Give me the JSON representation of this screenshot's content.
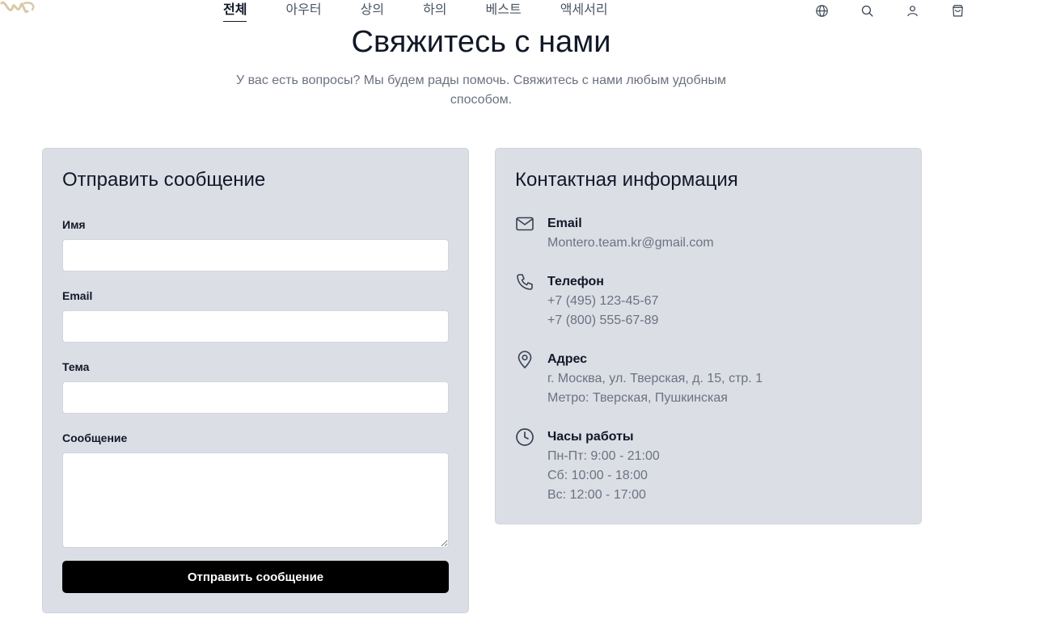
{
  "nav": {
    "items": [
      {
        "label": "전체",
        "active": true
      },
      {
        "label": "아우터"
      },
      {
        "label": "상의"
      },
      {
        "label": "하의"
      },
      {
        "label": "베스트"
      },
      {
        "label": "액세서리"
      }
    ],
    "icons": [
      "globe-icon",
      "search-icon",
      "user-icon",
      "cart-icon"
    ]
  },
  "page": {
    "title": "Свяжитесь с нами",
    "subtitle": "У вас есть вопросы? Мы будем рады помочь. Свяжитесь с нами любым удобным способом."
  },
  "form": {
    "title": "Отправить сообщение",
    "name_label": "Имя",
    "name_value": "",
    "email_label": "Email",
    "email_value": "",
    "subject_label": "Тема",
    "subject_value": "",
    "message_label": "Сообщение",
    "message_value": "",
    "submit_label": "Отправить сообщение"
  },
  "contact": {
    "title": "Контактная информация",
    "email": {
      "heading": "Email",
      "lines": [
        "Montero.team.kr@gmail.com"
      ]
    },
    "phone": {
      "heading": "Телефон",
      "lines": [
        "+7 (495) 123-45-67",
        "+7 (800) 555-67-89"
      ]
    },
    "address": {
      "heading": "Адрес",
      "lines": [
        "г. Москва, ул. Тверская, д. 15, стр. 1",
        "Метро: Тверская, Пушкинская"
      ]
    },
    "hours": {
      "heading": "Часы работы",
      "lines": [
        "Пн-Пт: 9:00 - 21:00",
        "Сб: 10:00 - 18:00",
        "Вс: 12:00 - 17:00"
      ]
    }
  },
  "colors": {
    "card_bg": "#dcdee6",
    "button_bg": "#000000",
    "muted_text": "#6b7280",
    "logo_gold": "#d9c9a8"
  }
}
